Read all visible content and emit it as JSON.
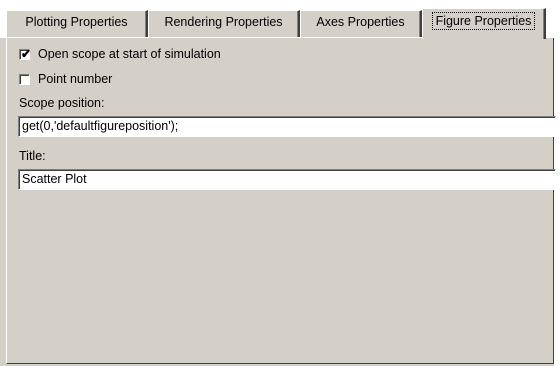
{
  "tabs": [
    {
      "label": "Plotting Properties",
      "active": false
    },
    {
      "label": "Rendering Properties",
      "active": false
    },
    {
      "label": "Axes Properties",
      "active": false
    },
    {
      "label": "Figure Properties",
      "active": true
    }
  ],
  "options": {
    "open_scope": {
      "label": "Open scope at start of simulation",
      "checked": true
    },
    "point_number": {
      "label": "Point number",
      "checked": false
    }
  },
  "scope_position": {
    "label": "Scope position:",
    "value": "get(0,'defaultfigureposition');"
  },
  "title_field": {
    "label": "Title:",
    "value": "Scatter Plot"
  }
}
